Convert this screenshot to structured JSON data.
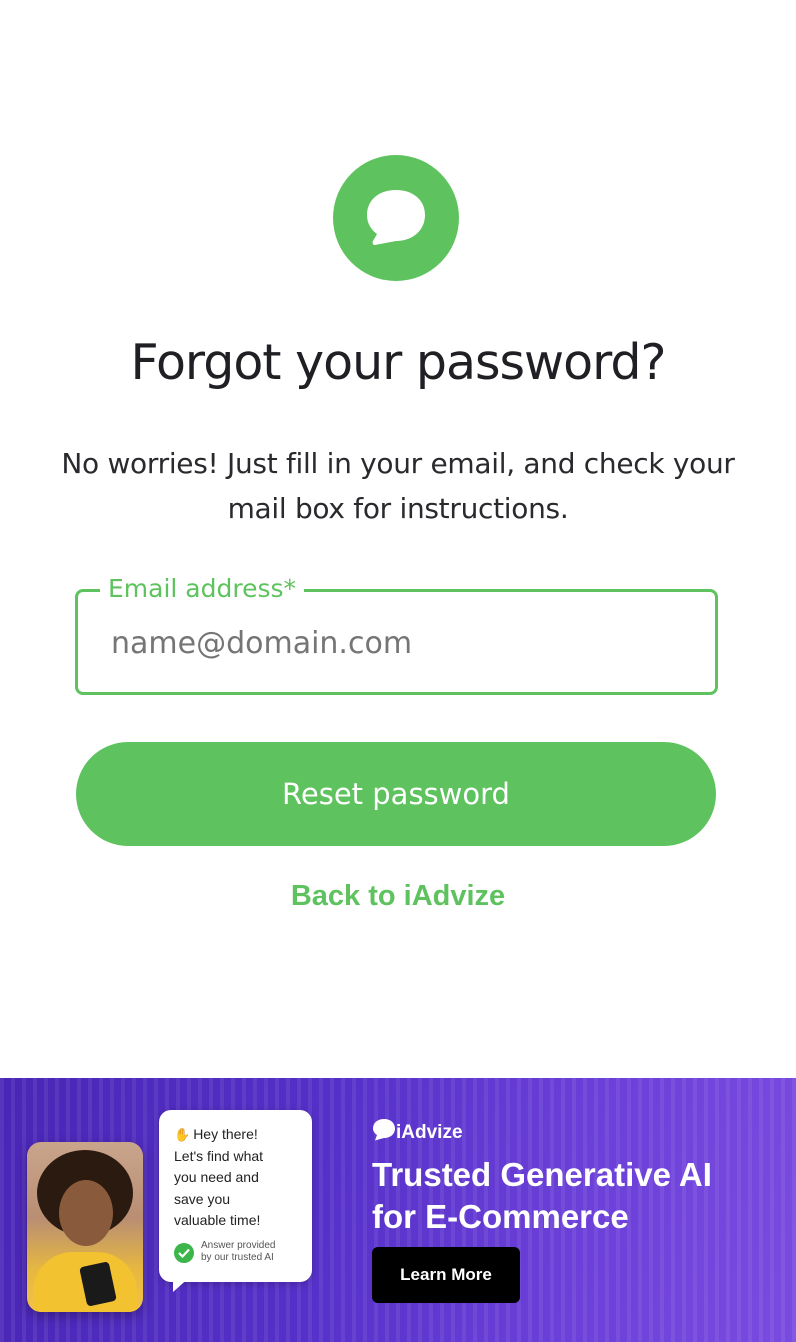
{
  "icons": {
    "logo": "chat-bubble-icon",
    "checkmark": "check-icon",
    "brand": "iadvize-logo-icon",
    "wave": "waving-hand-icon"
  },
  "colors": {
    "accent": "#5ec35e",
    "title": "#1f1f24",
    "banner_bg": "#5530c8",
    "learn_button_bg": "#000000"
  },
  "page": {
    "title": "Forgot your password?",
    "subtitle": "No worries! Just fill in your email, and check your mail box for instructions."
  },
  "form": {
    "email_label": "Email address*",
    "email_placeholder": "name@domain.com",
    "email_value": "",
    "submit_label": "Reset password",
    "back_link_label": "Back to iAdvize"
  },
  "banner": {
    "chat_greeting": "Hey there!",
    "chat_message": "Let's find what\nyou need and\nsave you\nvaluable time!",
    "answer_note": "Answer provided\nby our trusted AI",
    "brand_name": "iAdvize",
    "headline": "Trusted Generative AI\nfor E-Commerce",
    "cta_label": "Learn More"
  }
}
